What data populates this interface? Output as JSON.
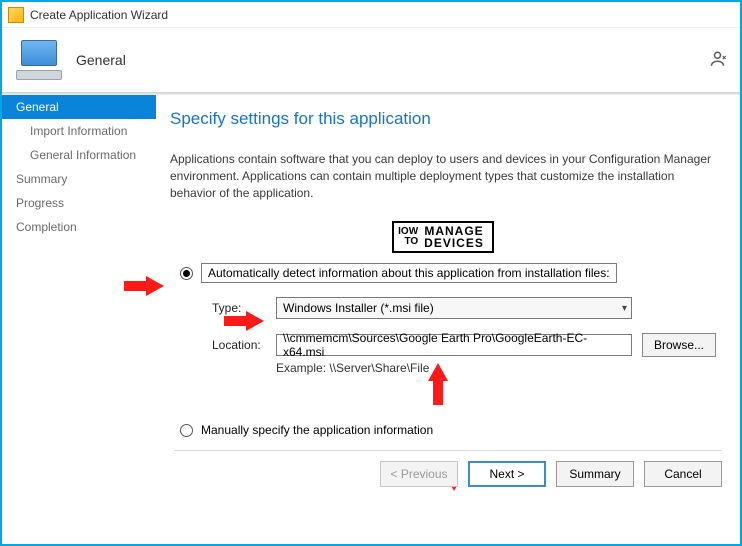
{
  "window": {
    "title": "Create Application Wizard"
  },
  "header": {
    "title": "General"
  },
  "sidebar": {
    "items": [
      {
        "label": "General",
        "active": true
      },
      {
        "label": "Import Information",
        "indent": true
      },
      {
        "label": "General Information",
        "indent": true
      },
      {
        "label": "Summary"
      },
      {
        "label": "Progress"
      },
      {
        "label": "Completion"
      }
    ]
  },
  "main": {
    "title": "Specify settings for this application",
    "description": "Applications contain software that you can deploy to users and devices in your Configuration Manager environment. Applications can contain multiple deployment types that customize the installation behavior of the application.",
    "watermark": {
      "left_top": "IOW",
      "left_bottom": "TO",
      "right_top": "MANAGE",
      "right_bottom": "DEVICES"
    },
    "option_auto": {
      "label": "Automatically detect information about this application from installation files:",
      "checked": true
    },
    "type": {
      "label": "Type:",
      "value": "Windows Installer (*.msi file)"
    },
    "location": {
      "label": "Location:",
      "value": "\\\\cmmemcm\\Sources\\Google Earth Pro\\GoogleEarth-EC-x64.msi",
      "browse": "Browse...",
      "example_label": "Example: \\\\Server\\Share\\File"
    },
    "option_manual": {
      "label": "Manually specify the application information",
      "checked": false
    }
  },
  "buttons": {
    "previous": "< Previous",
    "next": "Next >",
    "summary": "Summary",
    "cancel": "Cancel"
  }
}
